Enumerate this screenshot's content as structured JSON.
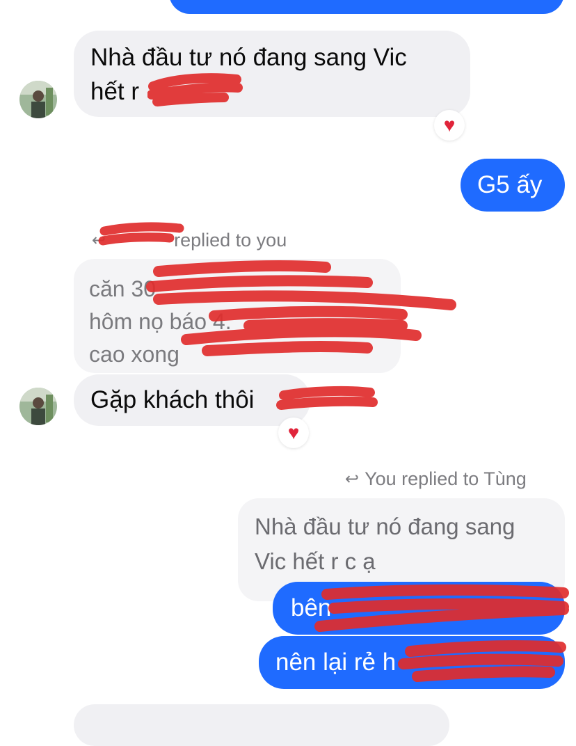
{
  "colors": {
    "outgoing": "#1f6bff",
    "incoming": "#f0f0f3",
    "redaction": "#e02d2d",
    "heart": "#e0243a"
  },
  "messages": [
    {
      "from": "them",
      "text": "Nhà đầu tư nó đang sang Vic\nhết r",
      "reaction": "heart-icon"
    },
    {
      "from": "me",
      "text": "G5 ấy"
    },
    {
      "from": "them",
      "reply_meta": "replied to you",
      "quote": "căn 30\nhôm nọ báo 4.\ncao xong",
      "text": "Gặp khách thôi",
      "reaction": "heart-icon"
    },
    {
      "from": "me",
      "reply_meta": "You replied to Tùng",
      "quote": "Nhà đầu tư nó đang sang\nVic hết r c ạ",
      "lines": [
        "bên",
        "nên lại rẻ h"
      ]
    }
  ]
}
